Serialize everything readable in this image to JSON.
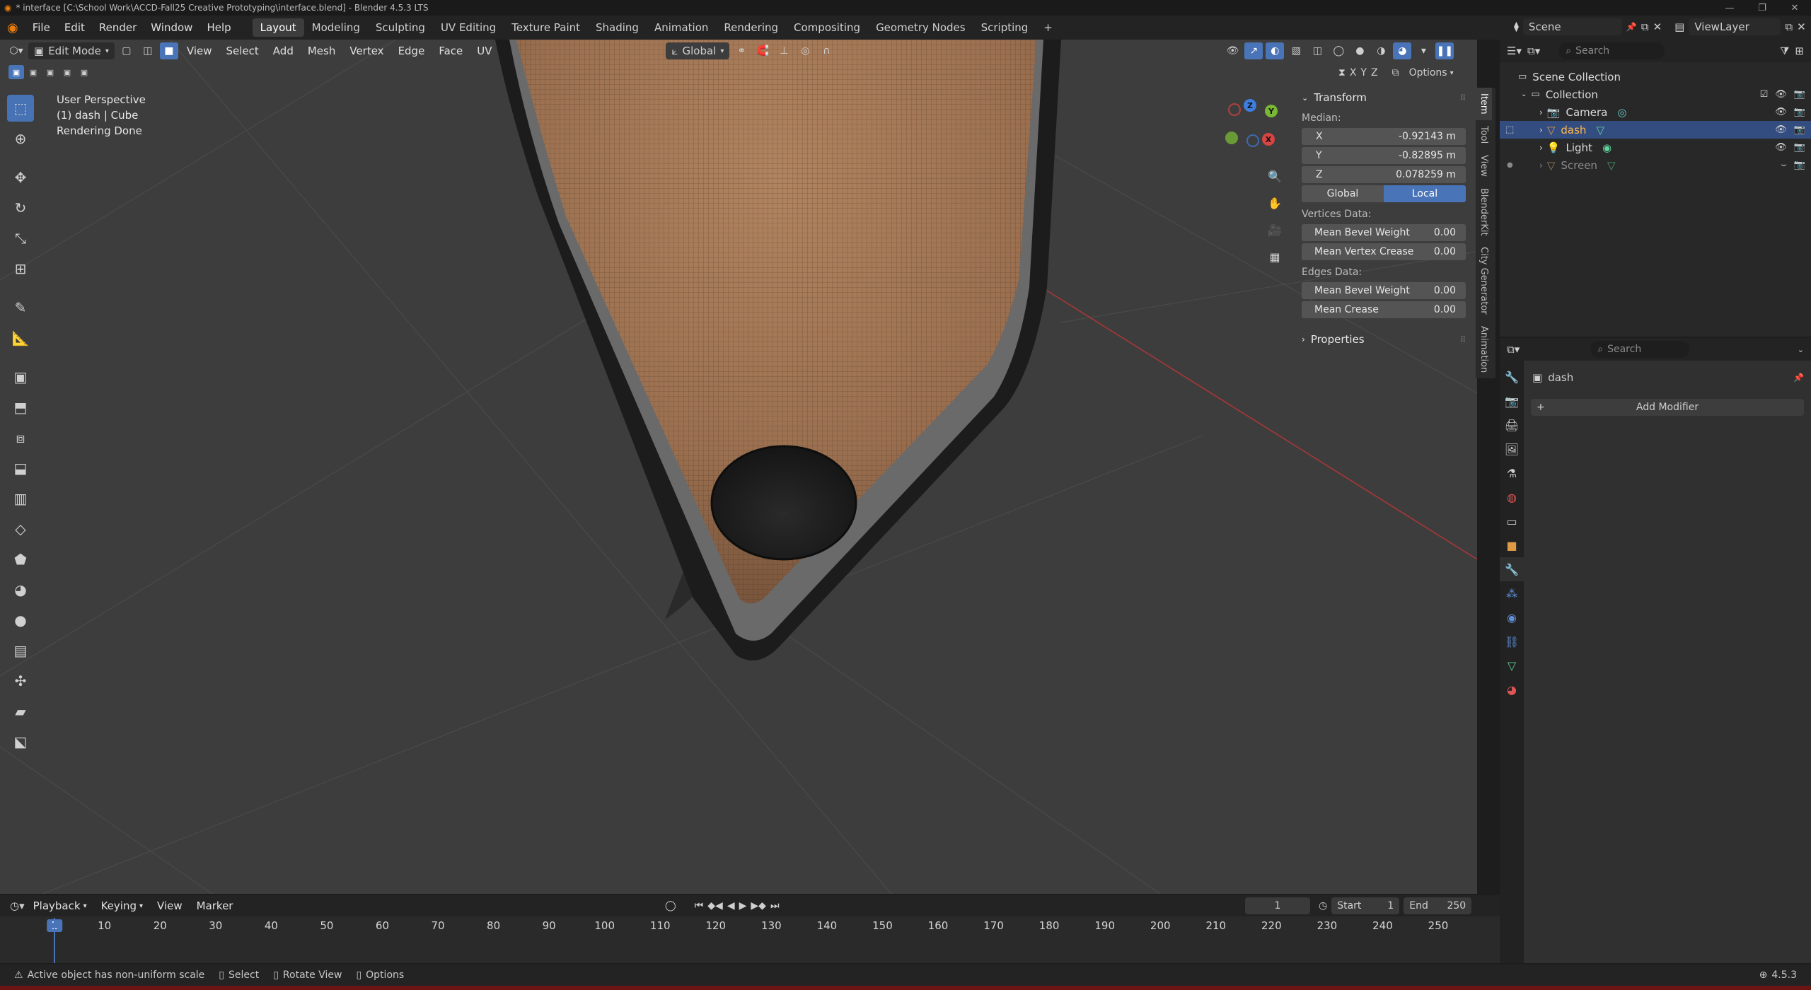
{
  "window": {
    "title": "* interface [C:\\School Work\\ACCD-Fall25 Creative Prototyping\\interface.blend] - Blender 4.5.3 LTS"
  },
  "menu": [
    "File",
    "Edit",
    "Render",
    "Window",
    "Help"
  ],
  "workspaces": [
    "Layout",
    "Modeling",
    "Sculpting",
    "UV Editing",
    "Texture Paint",
    "Shading",
    "Animation",
    "Rendering",
    "Compositing",
    "Geometry Nodes",
    "Scripting"
  ],
  "scene": {
    "name": "Scene",
    "view_layer": "ViewLayer"
  },
  "viewport": {
    "mode": "Edit Mode",
    "menus": [
      "View",
      "Select",
      "Add",
      "Mesh",
      "Vertex",
      "Edge",
      "Face",
      "UV"
    ],
    "orientation": "Global",
    "options_label": "Options",
    "axis_labels": [
      "X",
      "Y",
      "Z"
    ],
    "info": [
      "User Perspective",
      "(1) dash | Cube",
      "Rendering Done"
    ]
  },
  "gizmo": {
    "z": "Z",
    "y": "Y",
    "x": "X"
  },
  "npanel": {
    "transform_title": "Transform",
    "median_label": "Median:",
    "fields": [
      {
        "label": "X",
        "value": "-0.92143 m"
      },
      {
        "label": "Y",
        "value": "-0.82895 m"
      },
      {
        "label": "Z",
        "value": "0.078259 m"
      }
    ],
    "space_options": [
      "Global",
      "Local"
    ],
    "vertices_title": "Vertices Data:",
    "vertices": [
      {
        "label": "Mean Bevel Weight",
        "value": "0.00"
      },
      {
        "label": "Mean Vertex Crease",
        "value": "0.00"
      }
    ],
    "edges_title": "Edges Data:",
    "edges": [
      {
        "label": "Mean Bevel Weight",
        "value": "0.00"
      },
      {
        "label": "Mean Crease",
        "value": "0.00"
      }
    ],
    "properties_title": "Properties",
    "tabs": [
      "Item",
      "Tool",
      "View",
      "BlenderKit",
      "City Generator",
      "Animation"
    ]
  },
  "outliner": {
    "search_placeholder": "Search",
    "scene_collection": "Scene Collection",
    "collection": "Collection",
    "items": [
      "Camera",
      "dash",
      "Light",
      "Screen"
    ]
  },
  "properties": {
    "search_placeholder": "Search",
    "object_name": "dash",
    "add_modifier": "Add Modifier"
  },
  "timeline": {
    "menus": [
      "Playback",
      "Keying",
      "View",
      "Marker"
    ],
    "current_frame": "1",
    "start_label": "Start",
    "start": "1",
    "end_label": "End",
    "end": "250",
    "frame_marks": [
      "1",
      "10",
      "20",
      "30",
      "40",
      "50",
      "60",
      "70",
      "80",
      "90",
      "100",
      "110",
      "120",
      "130",
      "140",
      "150",
      "160",
      "170",
      "180",
      "190",
      "200",
      "210",
      "220",
      "230",
      "240",
      "250"
    ]
  },
  "status": {
    "warning": "Active object has non-uniform scale",
    "hints": [
      "Select",
      "Rotate View",
      "Options"
    ],
    "version": "4.5.3"
  }
}
